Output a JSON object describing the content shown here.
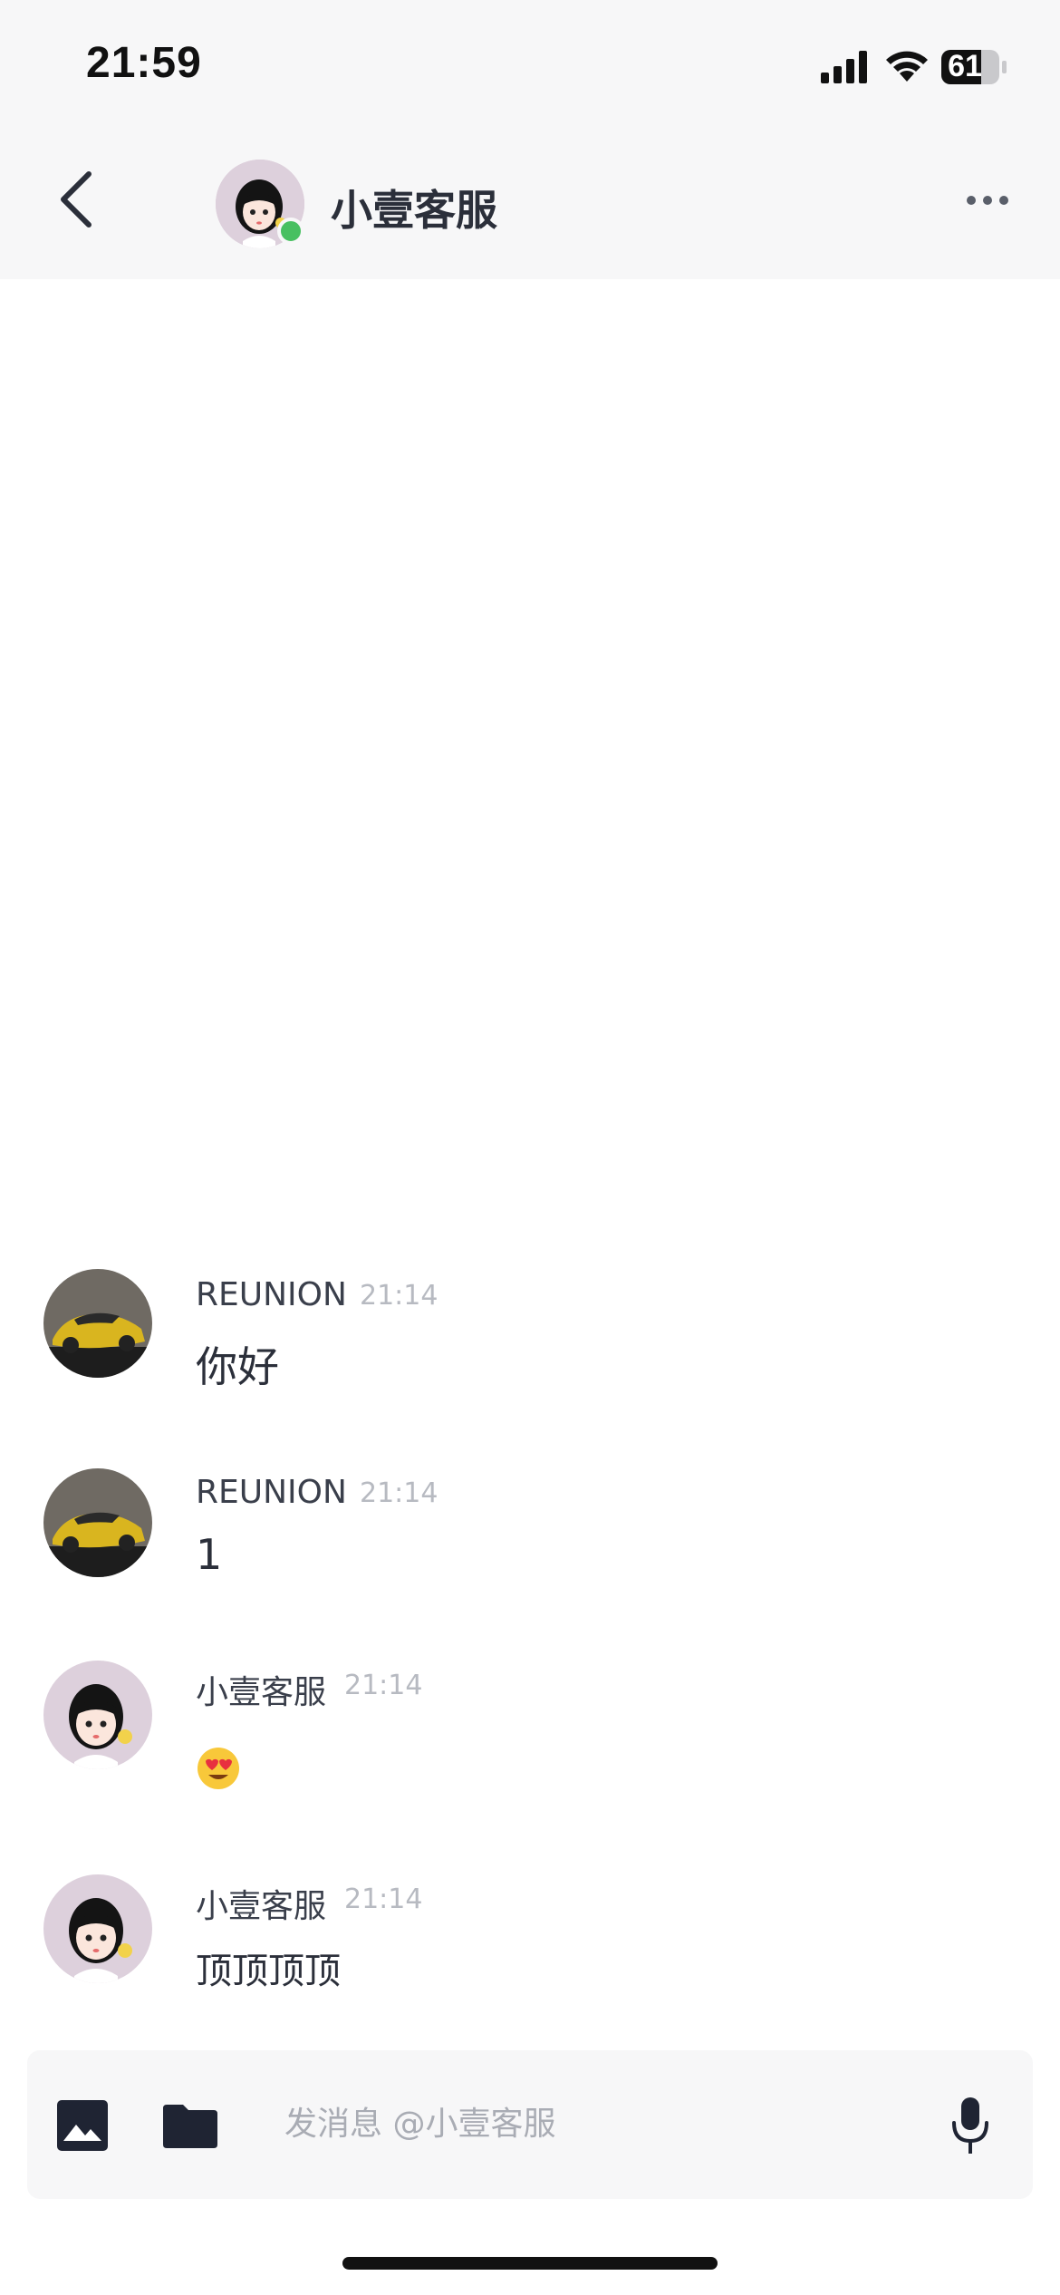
{
  "status_bar": {
    "time": "21:59",
    "battery": "61",
    "icons": [
      "signal-icon",
      "wifi-icon",
      "battery-icon"
    ]
  },
  "header": {
    "title": "小壹客服",
    "back_icon": "chevron-left-icon",
    "more_icon": "more-dots-icon",
    "online": true,
    "online_color": "#48c061"
  },
  "messages": [
    {
      "sender": "REUNION",
      "time": "21:14",
      "text": "你好",
      "avatar": "yellow-car-avatar"
    },
    {
      "sender": "REUNION",
      "time": "21:14",
      "text": "1",
      "avatar": "yellow-car-avatar"
    },
    {
      "sender": "小壹客服",
      "time": "21:14",
      "text": "",
      "emoji": "heart-eyes-emoji",
      "avatar": "cartoon-girl-avatar"
    },
    {
      "sender": "小壹客服",
      "time": "21:14",
      "text": "顶顶顶顶",
      "avatar": "cartoon-girl-avatar"
    }
  ],
  "input_bar": {
    "placeholder": "发消息 @小壹客服",
    "icons": [
      "image-icon",
      "folder-icon",
      "microphone-icon"
    ]
  },
  "colors": {
    "header_bg": "#f7f7f8",
    "text_primary": "#2b2f3a",
    "text_muted": "#b7bac1",
    "online_green": "#48c061"
  }
}
